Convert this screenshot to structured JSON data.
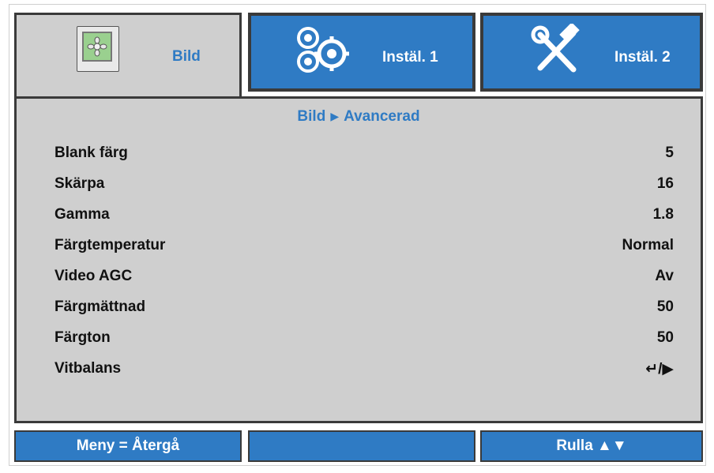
{
  "tabs": [
    {
      "label": "Bild",
      "icon": "picture-icon",
      "active": true
    },
    {
      "label": "Instäl. 1",
      "icon": "gears-icon",
      "active": false
    },
    {
      "label": "Instäl. 2",
      "icon": "tools-icon",
      "active": false
    }
  ],
  "breadcrumb": {
    "parent": "Bild",
    "separator": "▶",
    "current": "Avancerad"
  },
  "rows": [
    {
      "label": "Blank färg",
      "value": "5"
    },
    {
      "label": "Skärpa",
      "value": "16"
    },
    {
      "label": "Gamma",
      "value": "1.8"
    },
    {
      "label": "Färgtemperatur",
      "value": "Normal"
    },
    {
      "label": "Video AGC",
      "value": "Av"
    },
    {
      "label": "Färgmättnad",
      "value": "50"
    },
    {
      "label": "Färgton",
      "value": "50"
    },
    {
      "label": "Vitbalans",
      "value": "↵/▶"
    }
  ],
  "footer": {
    "left": "Meny = Återgå",
    "middle": "",
    "right": "Rulla ▲▼"
  },
  "colors": {
    "accent": "#2f7bc4",
    "panel": "#cfcfcf",
    "border": "#3a3a3a"
  }
}
